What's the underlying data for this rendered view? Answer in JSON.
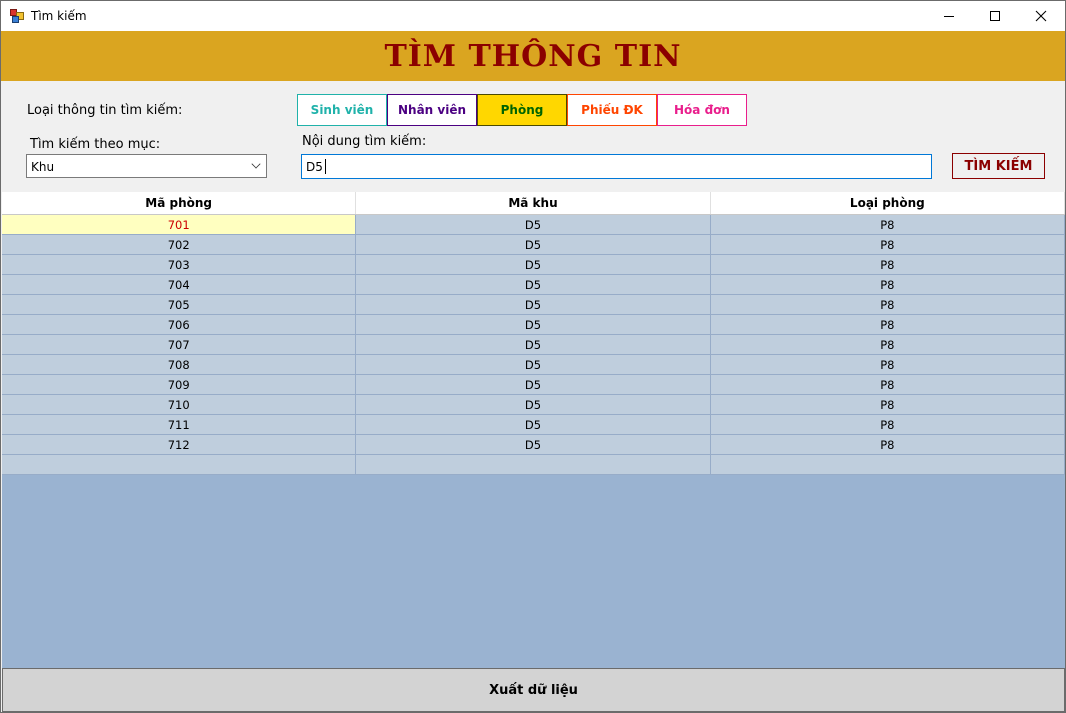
{
  "window": {
    "title": "Tìm kiếm"
  },
  "header": {
    "title": "TÌM THÔNG TIN"
  },
  "labels": {
    "type": "Loại thông tin tìm kiếm:",
    "category": "Tìm kiếm theo mục:",
    "content": "Nội dung tìm kiếm:"
  },
  "type_buttons": [
    {
      "label": "Sinh viên"
    },
    {
      "label": "Nhân viên"
    },
    {
      "label": "Phòng",
      "selected": true
    },
    {
      "label": "Phiếu ĐK"
    },
    {
      "label": "Hóa đơn"
    }
  ],
  "category_combo": {
    "value": "Khu"
  },
  "search": {
    "value": "D5",
    "button_label": "TÌM KIẾM"
  },
  "grid": {
    "columns": [
      "Mã phòng",
      "Mã khu",
      "Loại phòng"
    ],
    "rows": [
      [
        "701",
        "D5",
        "P8"
      ],
      [
        "702",
        "D5",
        "P8"
      ],
      [
        "703",
        "D5",
        "P8"
      ],
      [
        "704",
        "D5",
        "P8"
      ],
      [
        "705",
        "D5",
        "P8"
      ],
      [
        "706",
        "D5",
        "P8"
      ],
      [
        "707",
        "D5",
        "P8"
      ],
      [
        "708",
        "D5",
        "P8"
      ],
      [
        "709",
        "D5",
        "P8"
      ],
      [
        "710",
        "D5",
        "P8"
      ],
      [
        "711",
        "D5",
        "P8"
      ],
      [
        "712",
        "D5",
        "P8"
      ]
    ],
    "selected_row": 0
  },
  "export_button": {
    "label": "Xuất dữ liệu"
  },
  "colors": {
    "header_bg": "#daa520",
    "header_text": "#8b0000",
    "grid_bg": "#9ab3d1",
    "row_bg": "#bfcedd"
  }
}
